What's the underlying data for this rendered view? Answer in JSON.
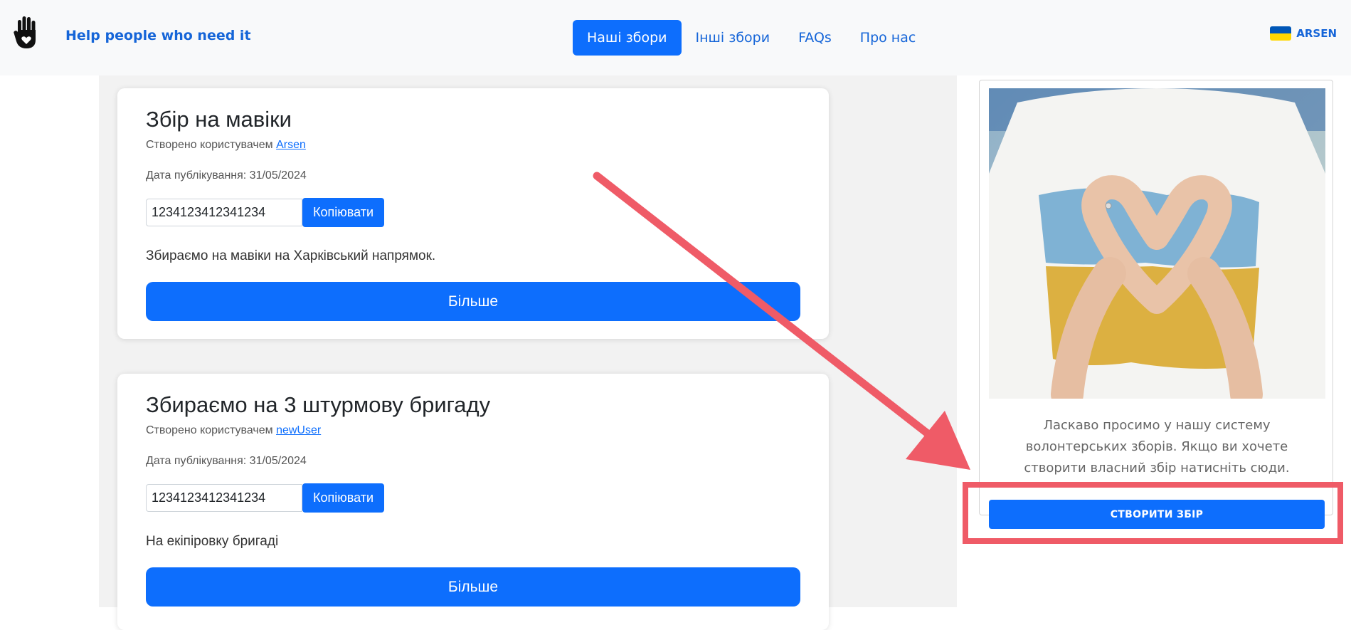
{
  "header": {
    "brand": "Help people who need it",
    "nav": [
      {
        "label": "Наші збори",
        "active": true
      },
      {
        "label": "Інші збори",
        "active": false
      },
      {
        "label": "FAQs",
        "active": false
      },
      {
        "label": "Про нас",
        "active": false
      }
    ],
    "user": {
      "name": "ARSEN",
      "icon": "ukraine-flag-icon"
    },
    "logo_icon": "raised-hand-heart-icon"
  },
  "cards": [
    {
      "title": "Збір на мавіки",
      "author_prefix": "Створено користувачем",
      "author": "Arsen",
      "date": "Дата публікування: 31/05/2024",
      "card_number": "1234123412341234",
      "copy_label": "Копіювати",
      "description": "Збираємо на мавіки на Харківський напрямок.",
      "more_label": "Більше"
    },
    {
      "title": "Збираємо на 3 штурмову бригаду",
      "author_prefix": "Створено користувачем",
      "author": "newUser",
      "date": "Дата публікування: 31/05/2024",
      "card_number": "1234123412341234",
      "copy_label": "Копіювати",
      "description": "На екіпіровку бригаді",
      "more_label": "Більше"
    }
  ],
  "sidebar": {
    "welcome_text": "Ласкаво просимо у нашу систему волонтерських зборів. Якщо ви хочете створити власний збір натисніть сюди.",
    "create_label": "СТВОРИТИ ЗБІР"
  },
  "colors": {
    "primary": "#0d6efd",
    "brand_text": "#1565d8",
    "annotation": "#ef5b67",
    "flag_blue": "#0057b7",
    "flag_yellow": "#ffd700"
  }
}
